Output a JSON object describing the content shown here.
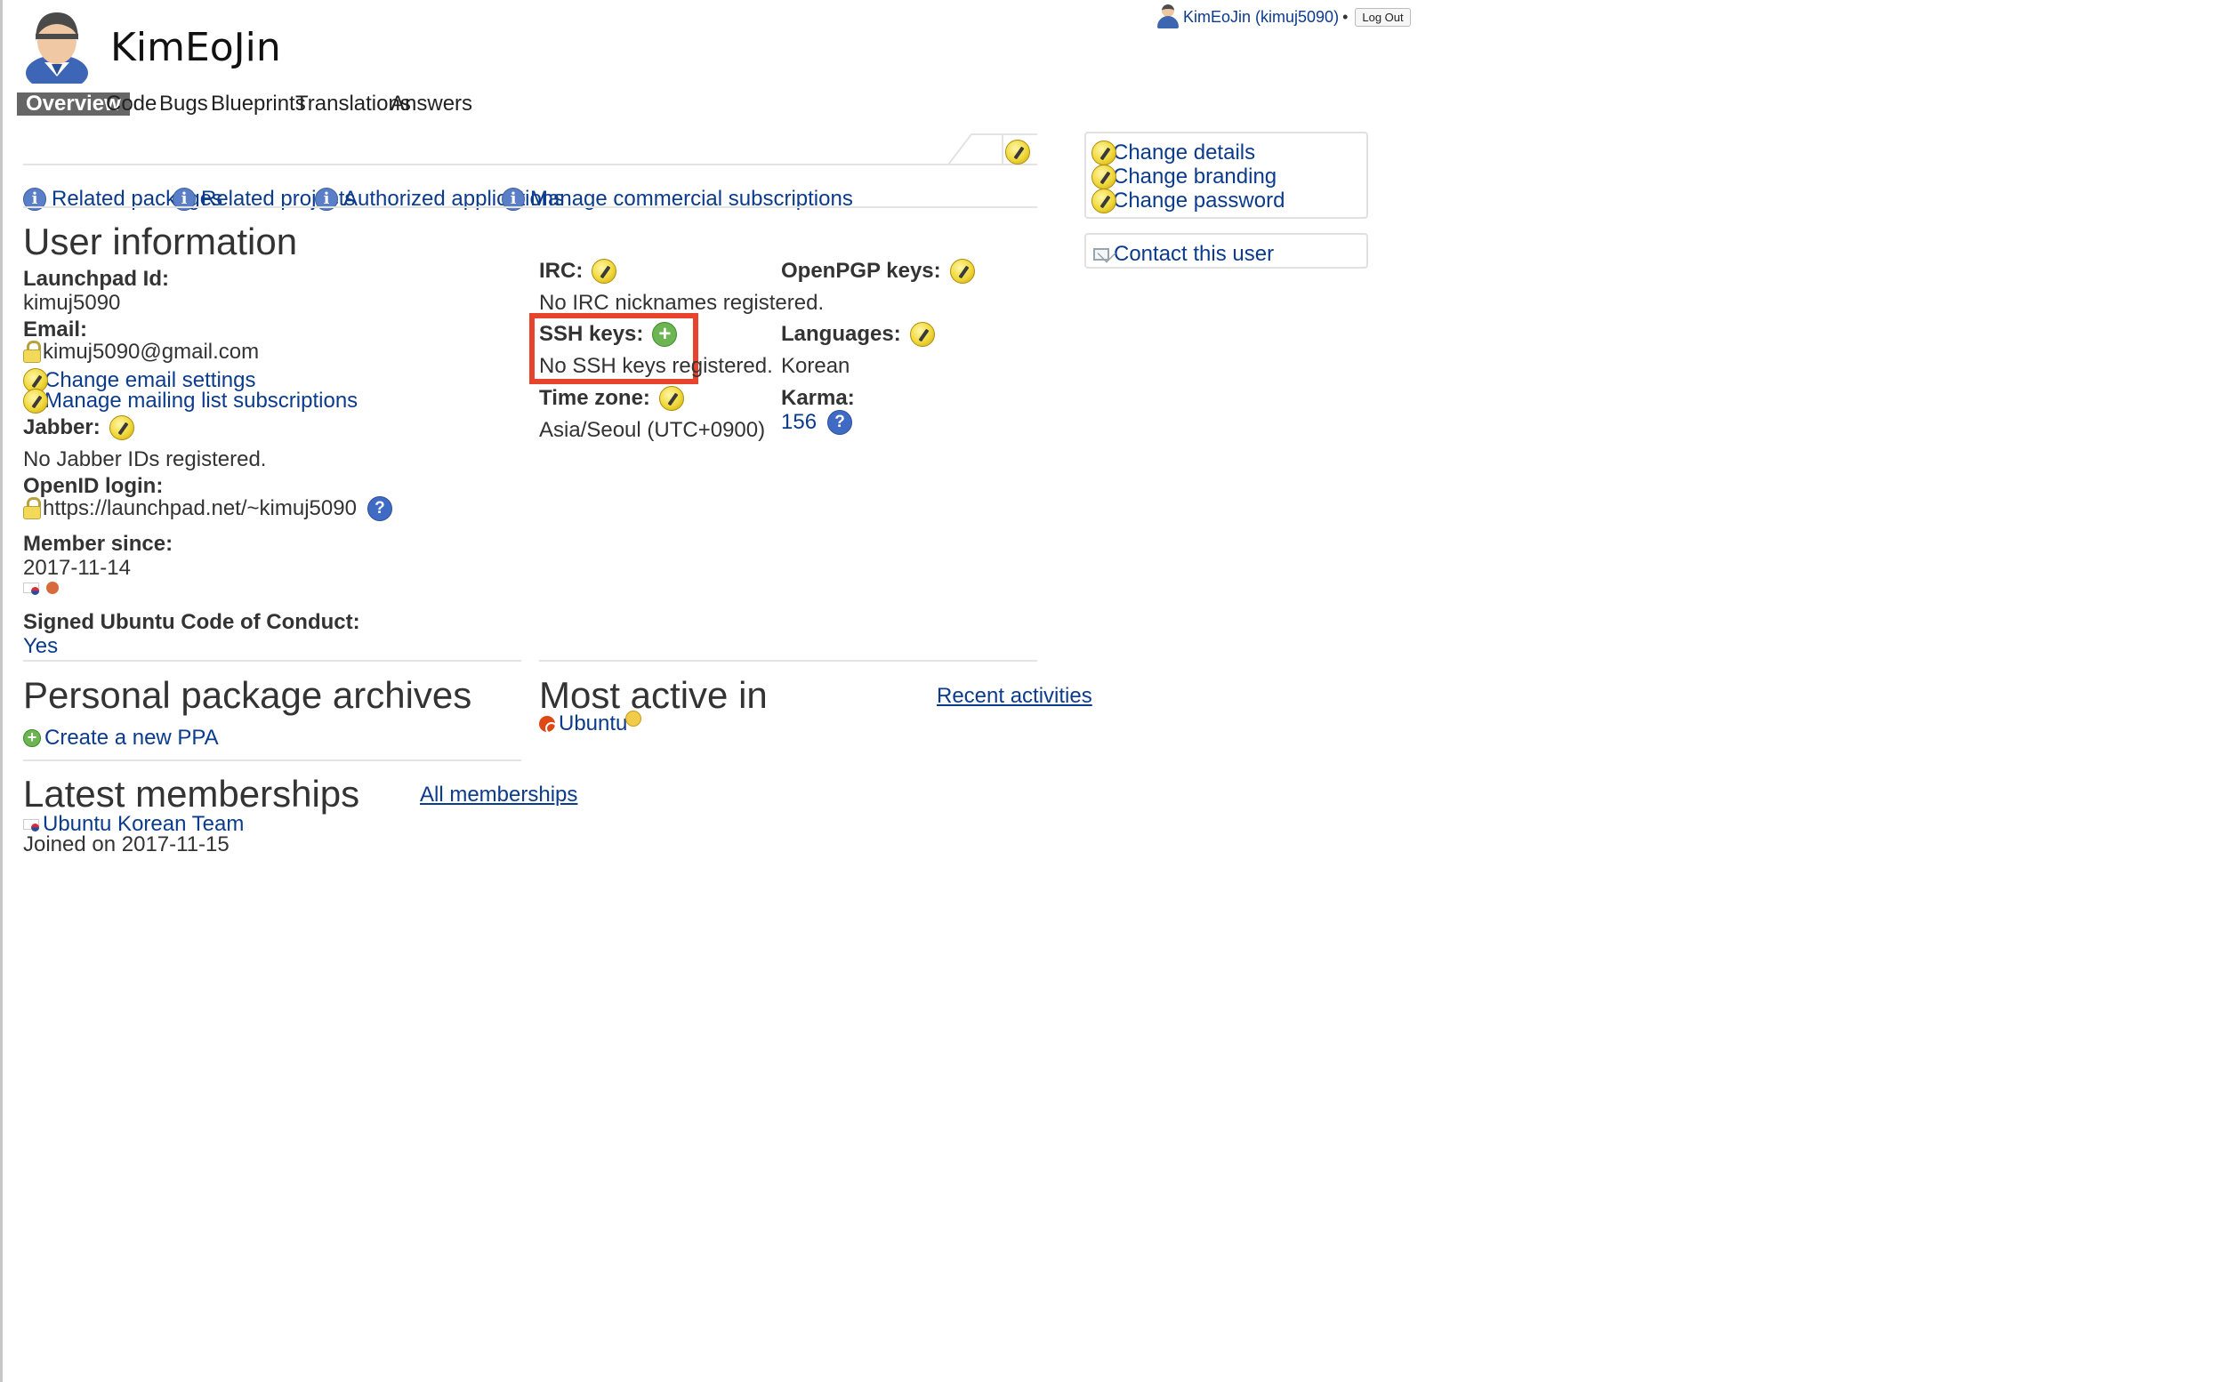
{
  "header": {
    "display_name": "KimEoJin",
    "user_link": "KimEoJin (kimuj5090)",
    "bullet": "•",
    "logout": "Log Out"
  },
  "tabs": [
    {
      "label": "Overview",
      "active": true
    },
    {
      "label": "Code"
    },
    {
      "label": "Bugs"
    },
    {
      "label": "Blueprints"
    },
    {
      "label": "Translations"
    },
    {
      "label": "Answers"
    }
  ],
  "related_links": [
    "Related packages",
    "Related projects",
    "Authorized applications",
    "Manage commercial subscriptions"
  ],
  "user_info": {
    "heading": "User information",
    "launchpad_id_label": "Launchpad Id:",
    "launchpad_id": "kimuj5090",
    "email_label": "Email:",
    "email": "kimuj5090@gmail.com",
    "change_email": "Change email settings",
    "manage_mailing": "Manage mailing list subscriptions",
    "jabber_label": "Jabber:",
    "jabber_value": "No Jabber IDs registered.",
    "openid_label": "OpenID login:",
    "openid_value": "https://launchpad.net/~kimuj5090",
    "member_since_label": "Member since:",
    "member_since": "2017-11-14",
    "coc_label": "Signed Ubuntu Code of Conduct:",
    "coc_value": "Yes",
    "irc_label": "IRC:",
    "irc_value": "No IRC nicknames registered.",
    "ssh_label": "SSH keys:",
    "ssh_value": "No SSH keys registered.",
    "timezone_label": "Time zone:",
    "timezone_value": "Asia/Seoul (UTC+0900)",
    "openpgp_label": "OpenPGP keys:",
    "languages_label": "Languages:",
    "languages_value": "Korean",
    "karma_label": "Karma:",
    "karma_value": "156"
  },
  "ppa": {
    "heading": "Personal package archives",
    "create": "Create a new PPA"
  },
  "most_active": {
    "heading": "Most active in",
    "recent": "Recent activities",
    "item": "Ubuntu"
  },
  "memberships": {
    "heading": "Latest memberships",
    "all": "All memberships",
    "team": "Ubuntu Korean Team",
    "joined": "Joined on 2017-11-15"
  },
  "sidebar": {
    "change_details": "Change details",
    "change_branding": "Change branding",
    "change_password": "Change password",
    "contact": "Contact this user"
  },
  "colors": {
    "link": "#0b3b8c",
    "highlight_box": "#e8432c",
    "active_tab_bg": "#666666"
  }
}
